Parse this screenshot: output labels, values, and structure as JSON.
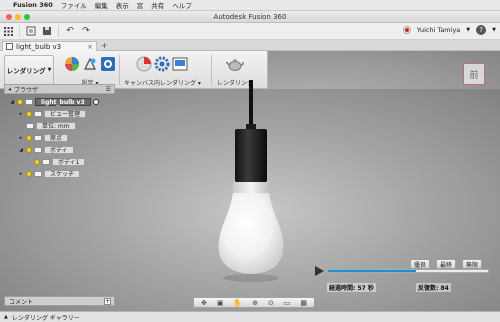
{
  "menubar": {
    "app": "Fusion 360",
    "items": [
      "ファイル",
      "編集",
      "表示",
      "窓",
      "共有",
      "ヘルプ"
    ]
  },
  "window": {
    "title": "Autodesk Fusion 360"
  },
  "toolbar": {
    "user": "Yuichi Tamiya"
  },
  "document_tab": {
    "label": "light_bulb v3"
  },
  "ribbon": {
    "workspace": "レンダリング",
    "groups": [
      "設定",
      "キャンバス内レンダリング",
      "レンダリング"
    ]
  },
  "browser": {
    "title": "ブラウザ",
    "nodes": [
      "light_bulb v3",
      "ビュー管理",
      "単位: mm",
      "原点",
      "ボディ",
      "ボディ1",
      "スケッチ"
    ]
  },
  "render": {
    "quality_buttons": [
      "優良",
      "最終",
      "無限"
    ],
    "elapsed_label": "経過時間: 57 秒",
    "iterations_label": "反復数: 84",
    "progress_fraction": 0.55
  },
  "comments": {
    "label": "コメント"
  },
  "gallery": {
    "label": "レンダリング ギャラリー"
  },
  "viewcube": {
    "face": "前"
  },
  "colors": {
    "accent": "#1f8fd3",
    "record": "#cc2222"
  }
}
